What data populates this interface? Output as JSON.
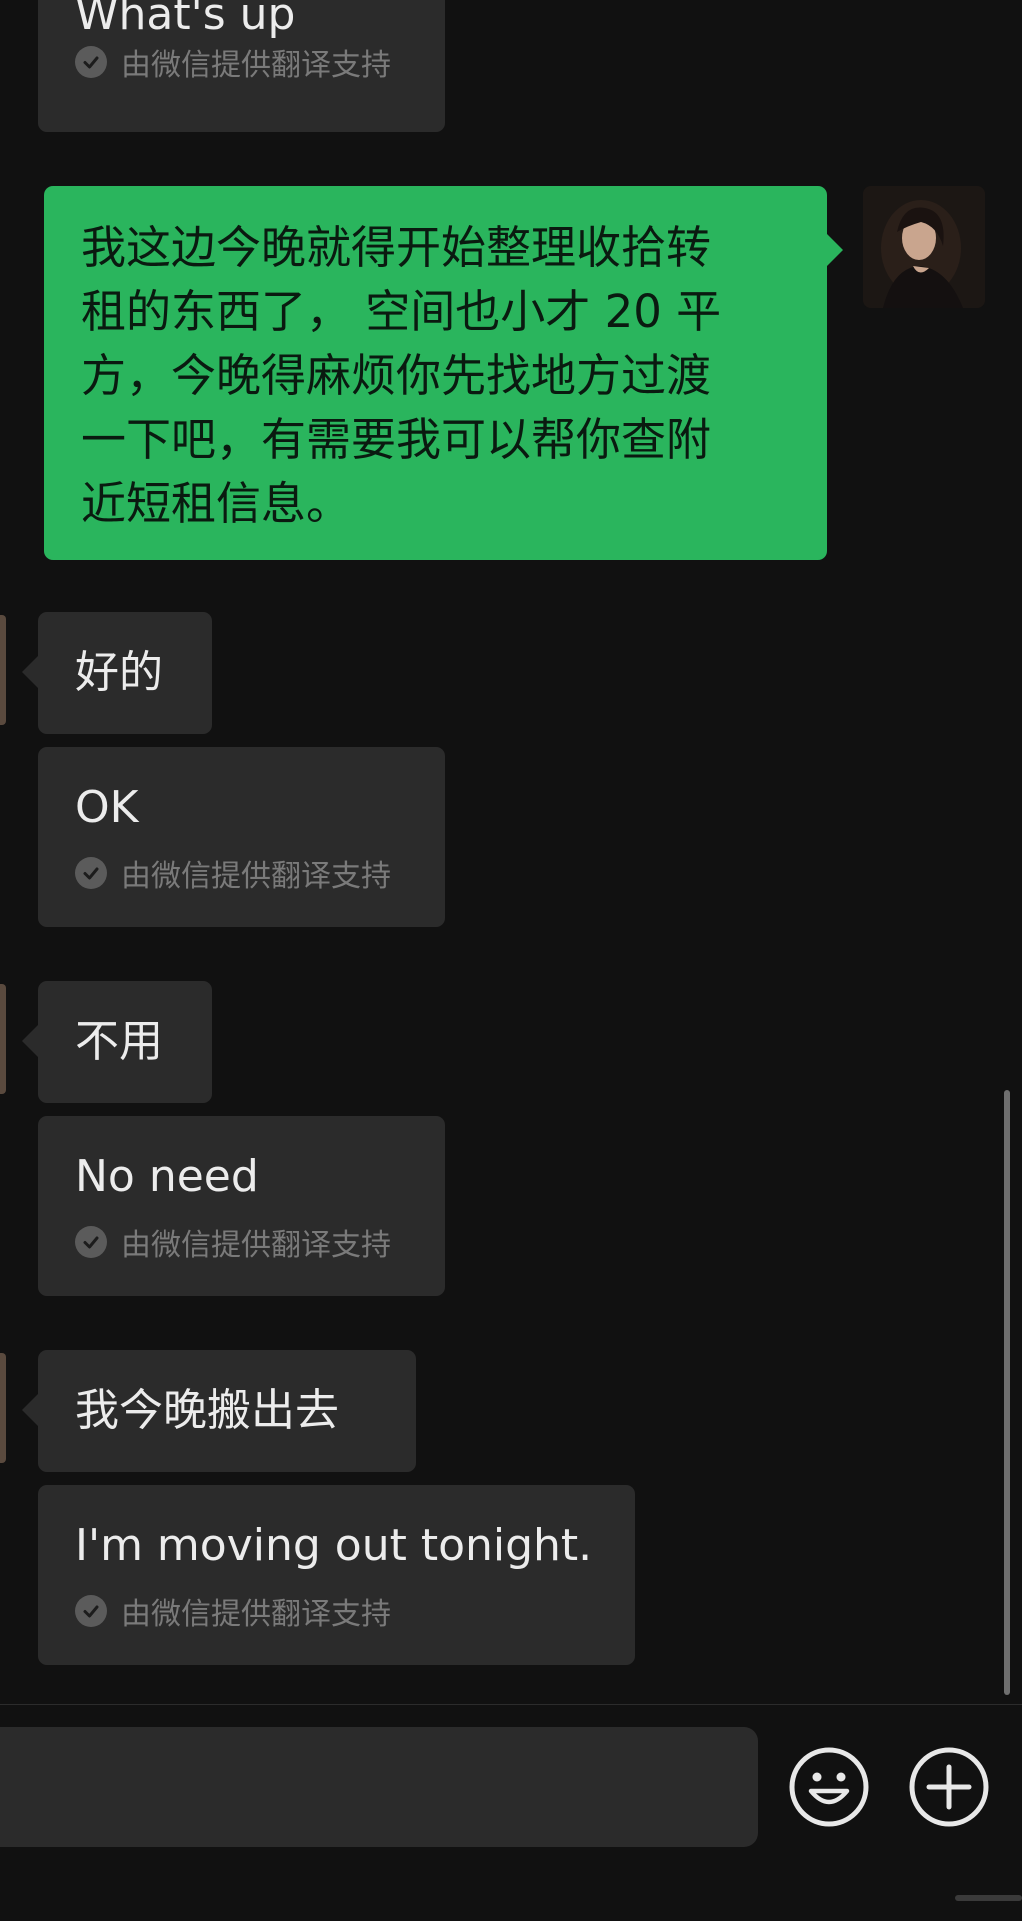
{
  "messages": [
    {
      "id": "m0",
      "sender": "other",
      "text": "What's up",
      "translation_note": "由微信提供翻译支持"
    },
    {
      "id": "m1",
      "sender": "self",
      "text": "我这边今晚就得开始整理收拾转\n租的东西了， 空间也小才 20 平\n方，今晚得麻烦你先找地方过渡\n一下吧，有需要我可以帮你查附\n近短租信息。"
    },
    {
      "id": "m2",
      "sender": "other",
      "text": "好的",
      "translation": "OK",
      "translation_note": "由微信提供翻译支持"
    },
    {
      "id": "m3",
      "sender": "other",
      "text": "不用",
      "translation": "No need",
      "translation_note": "由微信提供翻译支持"
    },
    {
      "id": "m4",
      "sender": "other",
      "text": "我今晚搬出去",
      "translation": "I'm moving out tonight.",
      "translation_note": "由微信提供翻译支持"
    }
  ],
  "input_bar": {
    "value": "",
    "emoji_icon": "emoji-icon",
    "plus_icon": "plus-icon"
  },
  "colors": {
    "background": "#111111",
    "bubble_other": "#2b2b2b",
    "bubble_self": "#2ab55d",
    "muted_text": "#7a7a7a"
  }
}
